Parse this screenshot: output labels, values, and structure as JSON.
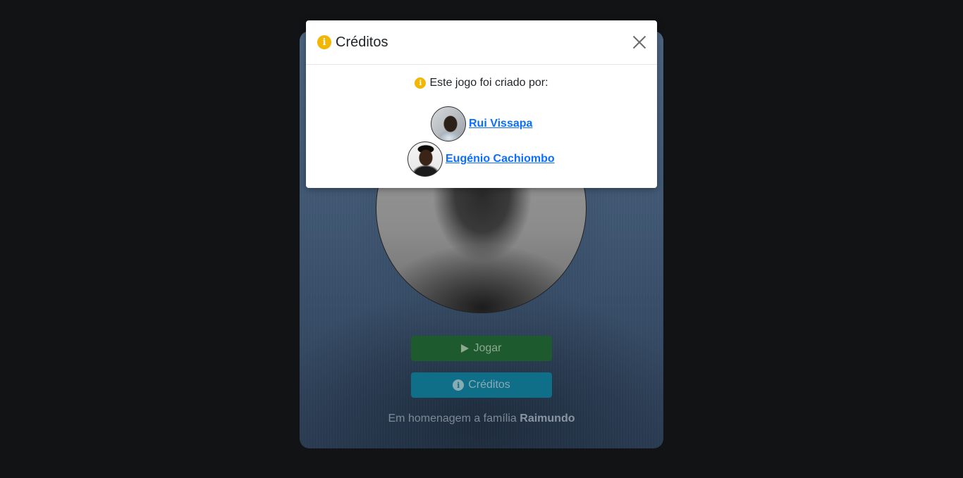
{
  "game": {
    "play_label": "Jogar",
    "credits_label": "Créditos",
    "tribute_prefix": "Em homenagem a família",
    "tribute_name": "Raimundo"
  },
  "modal": {
    "title": "Créditos",
    "intro": "Este jogo foi criado por:",
    "authors": [
      {
        "name": "Rui Vissapa"
      },
      {
        "name": "Eugénio Cachiombo"
      }
    ]
  },
  "colors": {
    "info_icon": "#f2b705",
    "link": "#0d6efd",
    "play_button": "#1d5a2e",
    "credits_button": "#0f6f88"
  }
}
